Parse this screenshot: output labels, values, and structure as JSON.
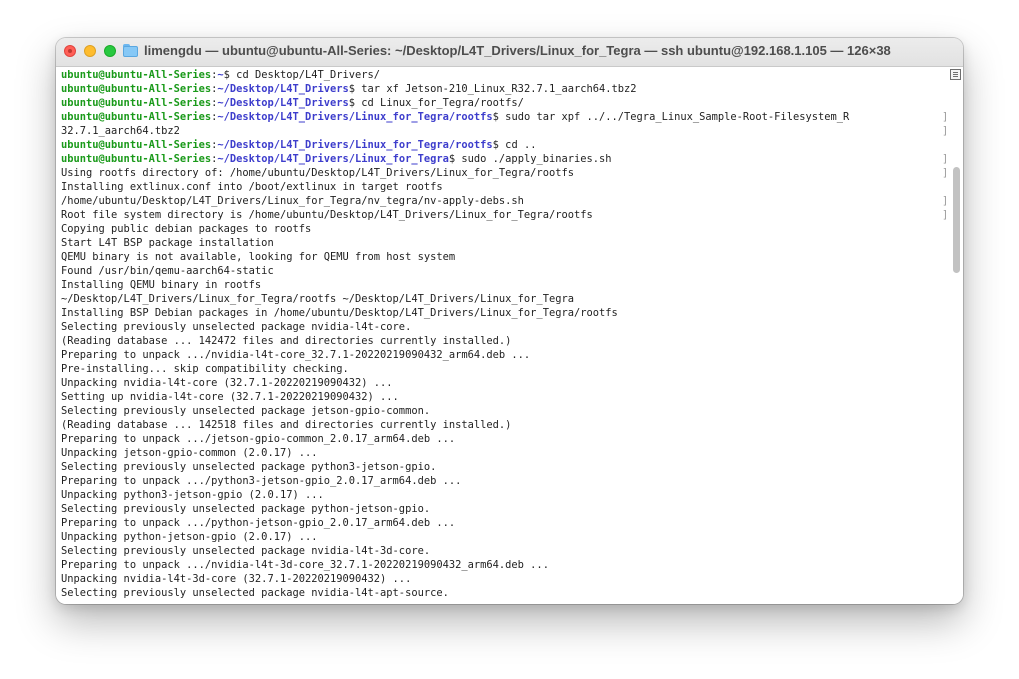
{
  "window": {
    "title": "limengdu — ubuntu@ubuntu-All-Series: ~/Desktop/L4T_Drivers/Linux_for_Tegra — ssh ubuntu@192.168.1.105 — 126×38"
  },
  "terminal": {
    "lines": [
      {
        "segments": [
          {
            "text": "ubuntu@ubuntu-All-Series",
            "style": "user"
          },
          {
            "text": ":",
            "style": "plain"
          },
          {
            "text": "~",
            "style": "path"
          },
          {
            "text": "$ cd Desktop/L4T_Drivers/",
            "style": "plain"
          }
        ],
        "wrapped_left": false,
        "wrapped_right": false
      },
      {
        "segments": [
          {
            "text": "ubuntu@ubuntu-All-Series",
            "style": "user"
          },
          {
            "text": ":",
            "style": "plain"
          },
          {
            "text": "~/Desktop/L4T_Drivers",
            "style": "path"
          },
          {
            "text": "$ tar xf Jetson-210_Linux_R32.7.1_aarch64.tbz2",
            "style": "plain"
          }
        ],
        "wrapped_left": false,
        "wrapped_right": false
      },
      {
        "segments": [
          {
            "text": "ubuntu@ubuntu-All-Series",
            "style": "user"
          },
          {
            "text": ":",
            "style": "plain"
          },
          {
            "text": "~/Desktop/L4T_Drivers",
            "style": "path"
          },
          {
            "text": "$ cd Linux_for_Tegra/rootfs/",
            "style": "plain"
          }
        ],
        "wrapped_left": false,
        "wrapped_right": false
      },
      {
        "segments": [
          {
            "text": "ubuntu@ubuntu-All-Series",
            "style": "user"
          },
          {
            "text": ":",
            "style": "plain"
          },
          {
            "text": "~/Desktop/L4T_Drivers/Linux_for_Tegra/rootfs",
            "style": "path"
          },
          {
            "text": "$ sudo tar xpf ../../Tegra_Linux_Sample-Root-Filesystem_R",
            "style": "plain"
          }
        ],
        "wrapped_left": true,
        "wrapped_right": true
      },
      {
        "segments": [
          {
            "text": "32.7.1_aarch64.tbz2",
            "style": "plain"
          }
        ],
        "wrapped_left": false,
        "wrapped_right": true
      },
      {
        "segments": [
          {
            "text": "ubuntu@ubuntu-All-Series",
            "style": "user"
          },
          {
            "text": ":",
            "style": "plain"
          },
          {
            "text": "~/Desktop/L4T_Drivers/Linux_for_Tegra/rootfs",
            "style": "path"
          },
          {
            "text": "$ cd ..",
            "style": "plain"
          }
        ],
        "wrapped_left": true,
        "wrapped_right": false
      },
      {
        "segments": [
          {
            "text": "ubuntu@ubuntu-All-Series",
            "style": "user"
          },
          {
            "text": ":",
            "style": "plain"
          },
          {
            "text": "~/Desktop/L4T_Drivers/Linux_for_Tegra",
            "style": "path"
          },
          {
            "text": "$ sudo ./apply_binaries.sh",
            "style": "plain"
          }
        ],
        "wrapped_left": true,
        "wrapped_right": true
      },
      {
        "segments": [
          {
            "text": "Using rootfs directory of: /home/ubuntu/Desktop/L4T_Drivers/Linux_for_Tegra/rootfs",
            "style": "plain"
          }
        ],
        "wrapped_left": true,
        "wrapped_right": true
      },
      {
        "segments": [
          {
            "text": "Installing extlinux.conf into /boot/extlinux in target rootfs",
            "style": "plain"
          }
        ],
        "wrapped_left": false,
        "wrapped_right": false
      },
      {
        "segments": [
          {
            "text": "/home/ubuntu/Desktop/L4T_Drivers/Linux_for_Tegra/nv_tegra/nv-apply-debs.sh",
            "style": "plain"
          }
        ],
        "wrapped_left": true,
        "wrapped_right": true
      },
      {
        "segments": [
          {
            "text": "Root file system directory is /home/ubuntu/Desktop/L4T_Drivers/Linux_for_Tegra/rootfs",
            "style": "plain"
          }
        ],
        "wrapped_left": true,
        "wrapped_right": true
      },
      {
        "segments": [
          {
            "text": "Copying public debian packages to rootfs",
            "style": "plain"
          }
        ],
        "wrapped_left": false,
        "wrapped_right": false
      },
      {
        "segments": [
          {
            "text": "Start L4T BSP package installation",
            "style": "plain"
          }
        ],
        "wrapped_left": false,
        "wrapped_right": false
      },
      {
        "segments": [
          {
            "text": "QEMU binary is not available, looking for QEMU from host system",
            "style": "plain"
          }
        ],
        "wrapped_left": false,
        "wrapped_right": false
      },
      {
        "segments": [
          {
            "text": "Found /usr/bin/qemu-aarch64-static",
            "style": "plain"
          }
        ],
        "wrapped_left": false,
        "wrapped_right": false
      },
      {
        "segments": [
          {
            "text": "Installing QEMU binary in rootfs",
            "style": "plain"
          }
        ],
        "wrapped_left": false,
        "wrapped_right": false
      },
      {
        "segments": [
          {
            "text": "~/Desktop/L4T_Drivers/Linux_for_Tegra/rootfs ~/Desktop/L4T_Drivers/Linux_for_Tegra",
            "style": "plain"
          }
        ],
        "wrapped_left": false,
        "wrapped_right": false
      },
      {
        "segments": [
          {
            "text": "Installing BSP Debian packages in /home/ubuntu/Desktop/L4T_Drivers/Linux_for_Tegra/rootfs",
            "style": "plain"
          }
        ],
        "wrapped_left": false,
        "wrapped_right": false
      },
      {
        "segments": [
          {
            "text": "Selecting previously unselected package nvidia-l4t-core.",
            "style": "plain"
          }
        ],
        "wrapped_left": false,
        "wrapped_right": false
      },
      {
        "segments": [
          {
            "text": "(Reading database ... 142472 files and directories currently installed.)",
            "style": "plain"
          }
        ],
        "wrapped_left": false,
        "wrapped_right": false
      },
      {
        "segments": [
          {
            "text": "Preparing to unpack .../nvidia-l4t-core_32.7.1-20220219090432_arm64.deb ...",
            "style": "plain"
          }
        ],
        "wrapped_left": false,
        "wrapped_right": false
      },
      {
        "segments": [
          {
            "text": "Pre-installing... skip compatibility checking.",
            "style": "plain"
          }
        ],
        "wrapped_left": false,
        "wrapped_right": false
      },
      {
        "segments": [
          {
            "text": "Unpacking nvidia-l4t-core (32.7.1-20220219090432) ...",
            "style": "plain"
          }
        ],
        "wrapped_left": false,
        "wrapped_right": false
      },
      {
        "segments": [
          {
            "text": "Setting up nvidia-l4t-core (32.7.1-20220219090432) ...",
            "style": "plain"
          }
        ],
        "wrapped_left": false,
        "wrapped_right": false
      },
      {
        "segments": [
          {
            "text": "Selecting previously unselected package jetson-gpio-common.",
            "style": "plain"
          }
        ],
        "wrapped_left": false,
        "wrapped_right": false
      },
      {
        "segments": [
          {
            "text": "(Reading database ... 142518 files and directories currently installed.)",
            "style": "plain"
          }
        ],
        "wrapped_left": false,
        "wrapped_right": false
      },
      {
        "segments": [
          {
            "text": "Preparing to unpack .../jetson-gpio-common_2.0.17_arm64.deb ...",
            "style": "plain"
          }
        ],
        "wrapped_left": false,
        "wrapped_right": false
      },
      {
        "segments": [
          {
            "text": "Unpacking jetson-gpio-common (2.0.17) ...",
            "style": "plain"
          }
        ],
        "wrapped_left": false,
        "wrapped_right": false
      },
      {
        "segments": [
          {
            "text": "Selecting previously unselected package python3-jetson-gpio.",
            "style": "plain"
          }
        ],
        "wrapped_left": false,
        "wrapped_right": false
      },
      {
        "segments": [
          {
            "text": "Preparing to unpack .../python3-jetson-gpio_2.0.17_arm64.deb ...",
            "style": "plain"
          }
        ],
        "wrapped_left": false,
        "wrapped_right": false
      },
      {
        "segments": [
          {
            "text": "Unpacking python3-jetson-gpio (2.0.17) ...",
            "style": "plain"
          }
        ],
        "wrapped_left": false,
        "wrapped_right": false
      },
      {
        "segments": [
          {
            "text": "Selecting previously unselected package python-jetson-gpio.",
            "style": "plain"
          }
        ],
        "wrapped_left": false,
        "wrapped_right": false
      },
      {
        "segments": [
          {
            "text": "Preparing to unpack .../python-jetson-gpio_2.0.17_arm64.deb ...",
            "style": "plain"
          }
        ],
        "wrapped_left": false,
        "wrapped_right": false
      },
      {
        "segments": [
          {
            "text": "Unpacking python-jetson-gpio (2.0.17) ...",
            "style": "plain"
          }
        ],
        "wrapped_left": false,
        "wrapped_right": false
      },
      {
        "segments": [
          {
            "text": "Selecting previously unselected package nvidia-l4t-3d-core.",
            "style": "plain"
          }
        ],
        "wrapped_left": false,
        "wrapped_right": false
      },
      {
        "segments": [
          {
            "text": "Preparing to unpack .../nvidia-l4t-3d-core_32.7.1-20220219090432_arm64.deb ...",
            "style": "plain"
          }
        ],
        "wrapped_left": false,
        "wrapped_right": false
      },
      {
        "segments": [
          {
            "text": "Unpacking nvidia-l4t-3d-core (32.7.1-20220219090432) ...",
            "style": "plain"
          }
        ],
        "wrapped_left": false,
        "wrapped_right": false
      },
      {
        "segments": [
          {
            "text": "Selecting previously unselected package nvidia-l4t-apt-source.",
            "style": "plain"
          }
        ],
        "wrapped_left": false,
        "wrapped_right": false
      }
    ]
  },
  "colors": {
    "user": "#1a9a1a",
    "path": "#3d3dcc",
    "text": "#1f1f1f"
  },
  "icons": {
    "folder": "folder-icon",
    "scroll": "scroll-position-icon"
  }
}
